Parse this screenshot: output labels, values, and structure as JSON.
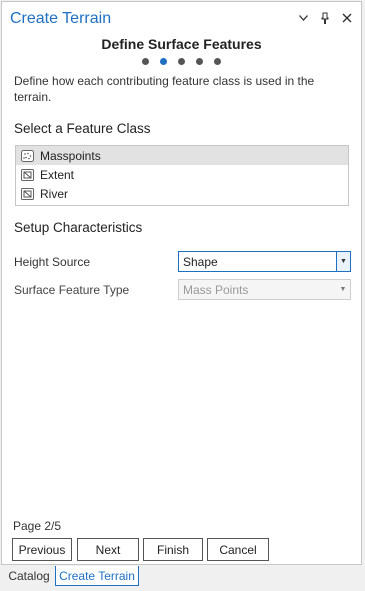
{
  "pane": {
    "title": "Create Terrain",
    "controls": {
      "dropdown": "▾",
      "pin": "📌",
      "close": "✕"
    }
  },
  "step": {
    "title": "Define Surface Features",
    "dots": 5,
    "active_dot": 2,
    "description": "Define how each contributing feature class is used in the terrain."
  },
  "feature_class": {
    "heading": "Select a Feature Class",
    "items": [
      {
        "label": "Masspoints",
        "icon": "masspoints-icon",
        "selected": true
      },
      {
        "label": "Extent",
        "icon": "polygon-icon",
        "selected": false
      },
      {
        "label": "River",
        "icon": "polygon-icon",
        "selected": false
      }
    ]
  },
  "setup": {
    "heading": "Setup Characteristics",
    "height_source": {
      "label": "Height Source",
      "value": "Shape"
    },
    "surface_feature_type": {
      "label": "Surface Feature Type",
      "value": "Mass Points"
    }
  },
  "footer": {
    "page": "Page 2/5",
    "buttons": {
      "previous": "Previous",
      "next": "Next",
      "finish": "Finish",
      "cancel": "Cancel"
    }
  },
  "tabs": {
    "catalog": "Catalog",
    "create_terrain": "Create Terrain"
  },
  "colors": {
    "accent": "#1e70c2",
    "selected_row": "#e2e2e2"
  }
}
